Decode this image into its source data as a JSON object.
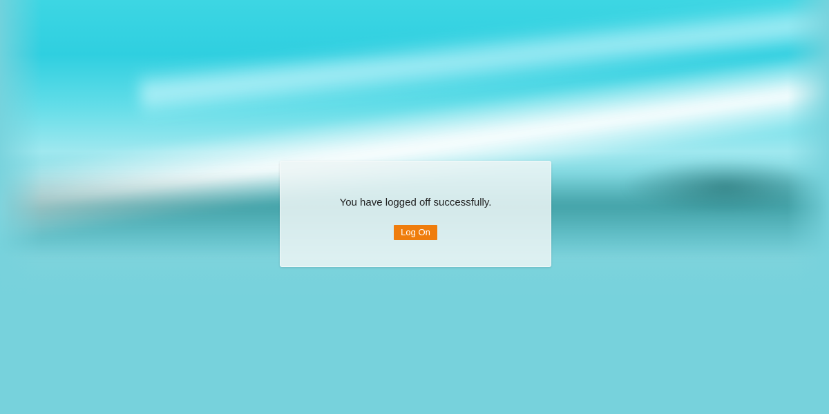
{
  "logoff_dialog": {
    "message": "You have logged off successfully.",
    "logon_button_label": "Log On"
  },
  "colors": {
    "background": "#77d2dc",
    "button_accent": "#ef7d0d",
    "dialog_background": "#ecf4f4",
    "message_text": "#222222"
  }
}
